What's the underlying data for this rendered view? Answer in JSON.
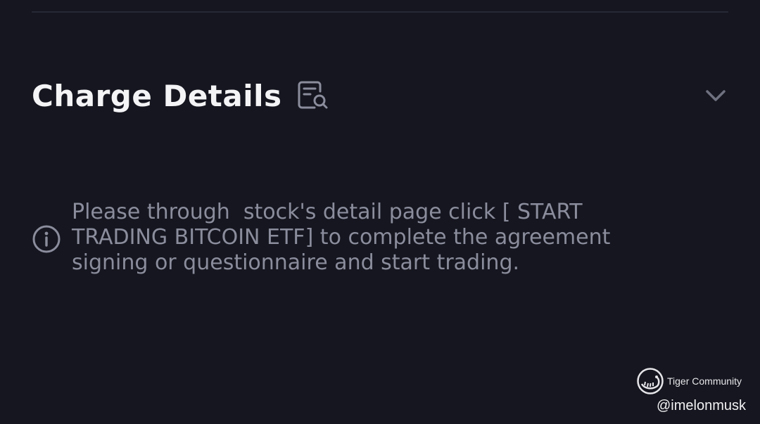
{
  "charge_details": {
    "title": "Charge Details",
    "title_icon": "document-search-icon",
    "expand_icon": "chevron-down-icon"
  },
  "notice": {
    "icon": "info-icon",
    "text": "Please through  stock's detail page click [ START TRADING BITCOIN ETF] to complete the agreement signing or questionnaire and start trading."
  },
  "watermark": {
    "brand": "Tiger Community",
    "handle": "@imelonmusk",
    "logo_icon": "tiger-community-logo"
  },
  "colors": {
    "background": "#15161f",
    "title": "#f4f4f6",
    "muted_text": "#8b8d9d",
    "divider": "#272935"
  }
}
